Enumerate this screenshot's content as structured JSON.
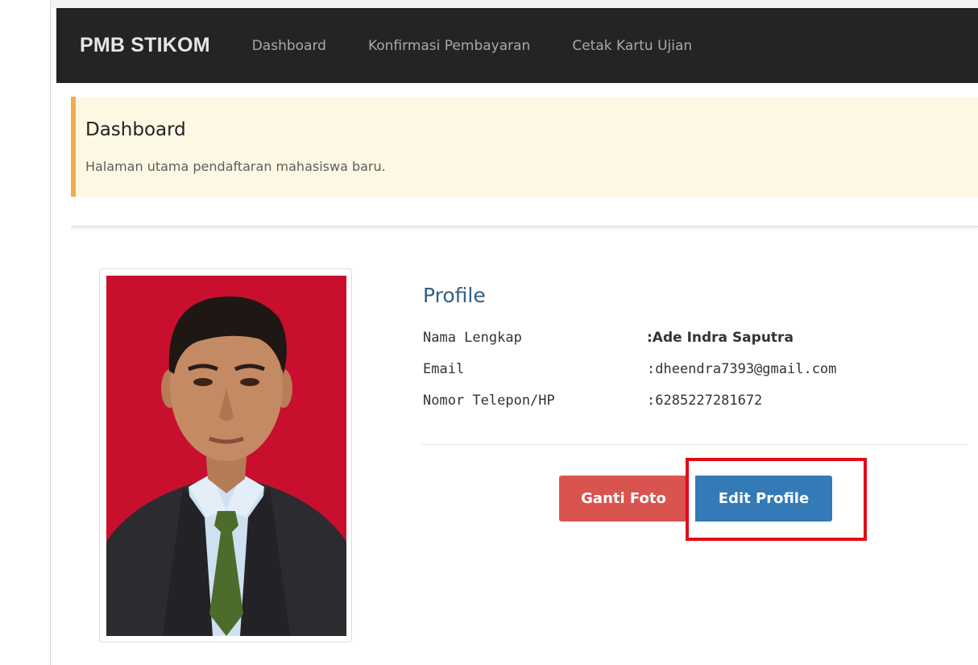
{
  "navbar": {
    "brand": "PMB STIKOM",
    "links": [
      {
        "label": "Dashboard"
      },
      {
        "label": "Konfirmasi Pembayaran"
      },
      {
        "label": "Cetak Kartu Ujian"
      }
    ]
  },
  "header": {
    "title": "Dashboard",
    "subtitle": "Halaman utama pendaftaran mahasiswa baru."
  },
  "profile": {
    "title": "Profile",
    "fields": [
      {
        "label": "Nama Lengkap",
        "value": ":Ade Indra Saputra"
      },
      {
        "label": "Email",
        "value": ":dheendra7393@gmail.com"
      },
      {
        "label": "Nomor Telepon/HP",
        "value": ":6285227281672"
      }
    ]
  },
  "actions": {
    "change_photo": "Ganti Foto",
    "edit_profile": "Edit Profile"
  },
  "colors": {
    "navbar_bg": "#242424",
    "callout_bg": "#fcf8e3",
    "callout_accent": "#f0ad4e",
    "profile_title": "#2f5f86",
    "danger": "#d9534f",
    "primary": "#337ab7",
    "highlight": "#e30b17",
    "photo_bg": "#c8102e"
  }
}
